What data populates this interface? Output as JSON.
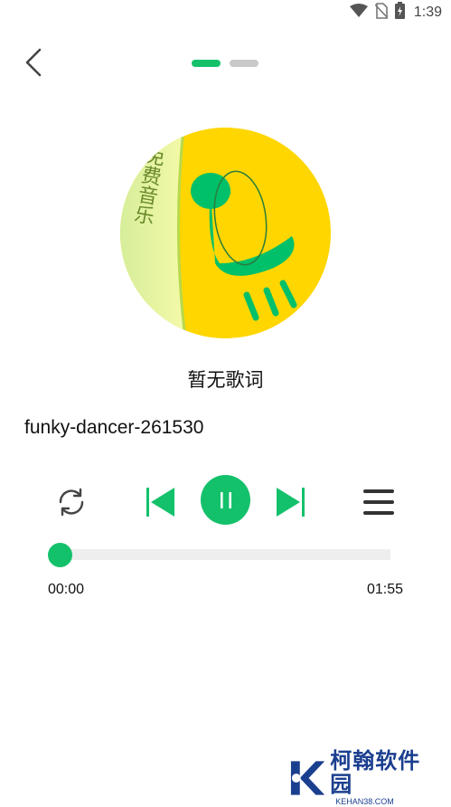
{
  "status_bar": {
    "time": "1:39",
    "icons": [
      "wifi-icon",
      "no-sim-icon",
      "battery-charging-icon"
    ]
  },
  "header": {
    "back_icon": "chevron-left-icon",
    "pages": [
      "active",
      "inactive"
    ]
  },
  "album": {
    "art_text": "免费音乐"
  },
  "player": {
    "lyrics_placeholder": "暂无歌词",
    "track_title": "funky-dancer-261530",
    "progress": 0,
    "time_current": "00:00",
    "time_total": "01:55",
    "controls": [
      "repeat-icon",
      "previous-icon",
      "pause-icon",
      "next-icon",
      "playlist-icon"
    ]
  },
  "colors": {
    "accent": "#14c16b",
    "track": "#eeeeee",
    "album_yellow": "#ffd600",
    "album_green": "#00c06a"
  },
  "watermark": {
    "main": "柯翰软件园",
    "sub": "KEHAN38.COM"
  }
}
